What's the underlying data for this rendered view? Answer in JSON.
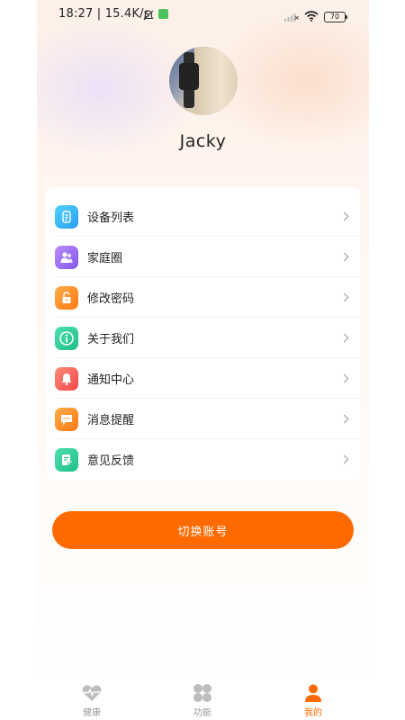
{
  "status_bar": {
    "time": "18:27 | 15.4K/s",
    "battery": "70"
  },
  "profile": {
    "username": "Jacky"
  },
  "menu": {
    "items": [
      {
        "label": "设备列表",
        "icon": "watch-icon",
        "color": "#35b8f0"
      },
      {
        "label": "家庭圈",
        "icon": "family-icon",
        "color": "#9b6cf0"
      },
      {
        "label": "修改密码",
        "icon": "lock-icon",
        "color": "#ff8a1e"
      },
      {
        "label": "关于我们",
        "icon": "info-icon",
        "color": "#27c796"
      },
      {
        "label": "通知中心",
        "icon": "bell-icon",
        "color": "#ff5a5a"
      },
      {
        "label": "消息提醒",
        "icon": "message-icon",
        "color": "#ff8a1e"
      },
      {
        "label": "意见反馈",
        "icon": "feedback-icon",
        "color": "#27c796"
      }
    ]
  },
  "switch_account_label": "切换账号",
  "tab_bar": {
    "tabs": [
      {
        "label": "健康",
        "icon": "heart-pulse-icon",
        "active": false
      },
      {
        "label": "功能",
        "icon": "grid-icon",
        "active": false
      },
      {
        "label": "我的",
        "icon": "person-icon",
        "active": true
      }
    ]
  },
  "colors": {
    "accent": "#ff6a00",
    "inactive_tab": "#9a9a9a"
  }
}
